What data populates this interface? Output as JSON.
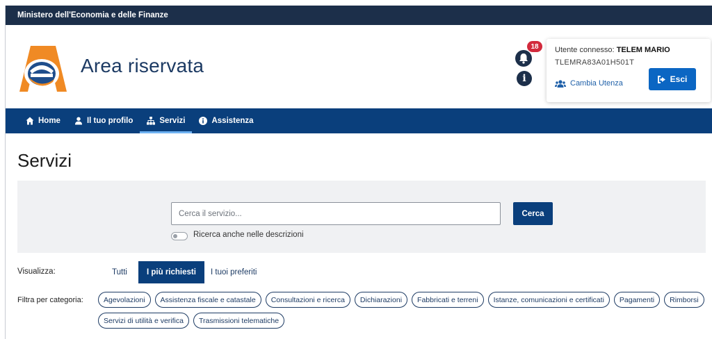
{
  "topbar": {
    "ministry": "Ministero dell'Economia e delle Finanze"
  },
  "header": {
    "title": "Area riservata",
    "notifications_count": "18",
    "user": {
      "connected_label": "Utente connesso:",
      "name": "TELEM MARIO",
      "fiscal_code": "TLEMRA83A01H501T",
      "switch_user_label": "Cambia Utenza",
      "logout_label": "Esci"
    }
  },
  "nav": {
    "items": [
      {
        "label": "Home",
        "icon": "home-icon"
      },
      {
        "label": "Il tuo profilo",
        "icon": "user-icon"
      },
      {
        "label": "Servizi",
        "icon": "sitemap-icon",
        "active": true
      },
      {
        "label": "Assistenza",
        "icon": "info-circle-icon"
      }
    ]
  },
  "page": {
    "title": "Servizi"
  },
  "search": {
    "placeholder": "Cerca il servizio...",
    "value": "",
    "button_label": "Cerca",
    "toggle_label": "Ricerca anche nelle descrizioni",
    "toggle_on": false
  },
  "view": {
    "label": "Visualizza:",
    "tabs": [
      {
        "label": "Tutti"
      },
      {
        "label": "I più richiesti",
        "active": true
      },
      {
        "label": "I tuoi preferiti"
      }
    ]
  },
  "filters": {
    "label": "Filtra per categoria:",
    "categories": [
      "Agevolazioni",
      "Assistenza fiscale e catastale",
      "Consultazioni e ricerca",
      "Dichiarazioni",
      "Fabbricati e terreni",
      "Istanze, comunicazioni e certificati",
      "Pagamenti",
      "Rimborsi",
      "Servizi di utilità e verifica",
      "Trasmissioni telematiche"
    ]
  },
  "colors": {
    "topbar": "#1c2f4a",
    "nav": "#0a3f7c",
    "primary_button": "#0b66c3",
    "badge": "#d22a3c",
    "logo_orange": "#f08a24",
    "logo_blue": "#1f4e8c"
  }
}
